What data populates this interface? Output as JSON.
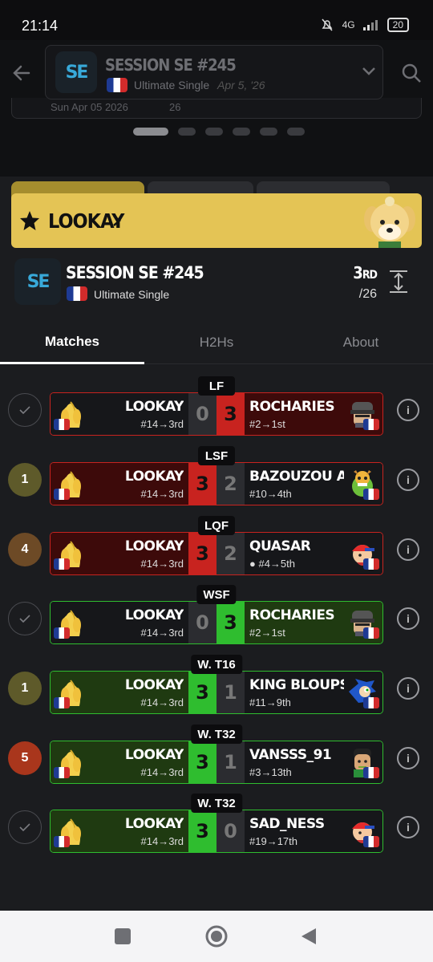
{
  "status": {
    "time": "21:14",
    "network": "4G",
    "battery": "20"
  },
  "header": {
    "title": "SESSION SE #245",
    "subtitle": "Ultimate Single",
    "date": "Apr 5, '26",
    "logo_text": "SE",
    "peek_text": "Sun Apr 05 2026",
    "peek_count": "26"
  },
  "banner": {
    "name": "LOOKAY"
  },
  "event": {
    "title": "SESSION SE #245",
    "subtitle": "Ultimate Single",
    "placement": "3",
    "placement_suffix": "RD",
    "entrants": "/26"
  },
  "tabs": [
    "Matches",
    "H2Hs",
    "About"
  ],
  "matches": [
    {
      "round": "LF",
      "badge": "",
      "left_name": "LOOKAY",
      "left_seed": "#14→3rd",
      "left_score": "0",
      "right_score": "3",
      "right_name": "ROCHARIES",
      "right_seed": "#2→1st",
      "result": "loss",
      "right_char": "snake"
    },
    {
      "round": "LSF",
      "badge": "1",
      "left_name": "LOOKAY",
      "left_seed": "#14→3rd",
      "left_score": "3",
      "right_score": "2",
      "right_name": "BAZOUZOU A B...",
      "right_seed": "#10→4th",
      "result": "win-red",
      "right_char": "bowserjr"
    },
    {
      "round": "LQF",
      "badge": "4",
      "left_name": "LOOKAY",
      "left_seed": "#14→3rd",
      "left_score": "3",
      "right_score": "2",
      "right_name": "QUASAR",
      "right_seed": "● #4→5th",
      "result": "win-red",
      "right_char": "ness"
    },
    {
      "round": "WSF",
      "badge": "",
      "left_name": "LOOKAY",
      "left_seed": "#14→3rd",
      "left_score": "0",
      "right_score": "3",
      "right_name": "ROCHARIES",
      "right_seed": "#2→1st",
      "result": "loss-green",
      "right_char": "snake"
    },
    {
      "round": "W. T16",
      "badge": "1",
      "left_name": "LOOKAY",
      "left_seed": "#14→3rd",
      "left_score": "3",
      "right_score": "1",
      "right_name": "KING BLOUPS",
      "right_seed": "#11→9th",
      "result": "win",
      "right_char": "sonic"
    },
    {
      "round": "W. T32",
      "badge": "5",
      "left_name": "LOOKAY",
      "left_seed": "#14→3rd",
      "left_score": "3",
      "right_score": "1",
      "right_name": "VANSSS_91",
      "right_seed": "#3→13th",
      "result": "win",
      "right_char": "littlemac"
    },
    {
      "round": "W. T32",
      "badge": "",
      "left_name": "LOOKAY",
      "left_seed": "#14→3rd",
      "left_score": "3",
      "right_score": "0",
      "right_name": "SAD_NESS",
      "right_seed": "#19→17th",
      "result": "win",
      "right_char": "ness"
    }
  ],
  "colors": {
    "win_green": "#2fbd2f",
    "loss_red": "#c8231f",
    "win_bg": "#1f3a11",
    "loss_bg": "#3d0a0a",
    "banner": "#e4c455"
  },
  "badges_colors": {
    "1": "#5e5a2a",
    "4": "#6d4a26",
    "5": "#a9361c"
  }
}
